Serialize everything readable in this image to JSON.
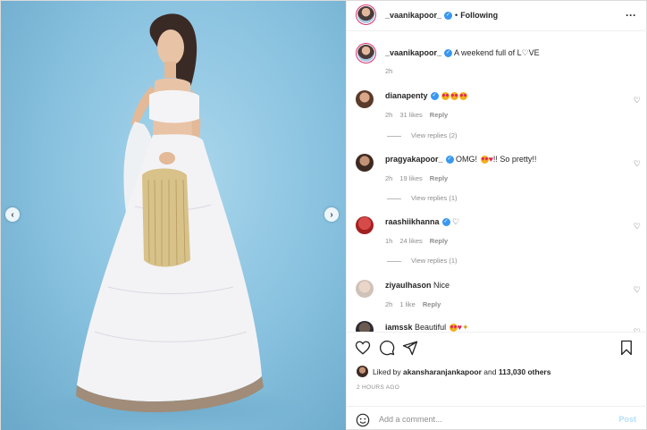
{
  "header": {
    "username": "_vaanikapoor_",
    "separator": "•",
    "follow_status": "Following",
    "more_label": "•••"
  },
  "caption": {
    "username": "_vaanikapoor_",
    "text": "A weekend full of L♡VE",
    "time": "2h"
  },
  "comments": [
    {
      "username": "dianapenty",
      "verified": true,
      "text": "",
      "time": "2h",
      "likes": "31 likes",
      "reply": "Reply",
      "view_replies": "View replies (2)"
    },
    {
      "username": "pragyakapoor_",
      "verified": true,
      "text_before": "OMG!",
      "text_after": "!! So pretty!!",
      "time": "2h",
      "likes": "19 likes",
      "reply": "Reply",
      "view_replies": "View replies (1)"
    },
    {
      "username": "raashiikhanna",
      "verified": true,
      "text": "",
      "time": "1h",
      "likes": "24 likes",
      "reply": "Reply",
      "view_replies": "View replies (1)"
    },
    {
      "username": "ziyaulhason",
      "verified": false,
      "text": "Nice",
      "time": "2h",
      "likes": "1 like",
      "reply": "Reply"
    },
    {
      "username": "iamssk",
      "verified": false,
      "text": "Beautiful",
      "time": "",
      "likes": "",
      "reply": ""
    }
  ],
  "likes": {
    "prefix": "Liked by",
    "user": "akansharanjankapoor",
    "and": "and",
    "count": "113,030 others"
  },
  "timestamp": "2 HOURS AGO",
  "add_comment": {
    "placeholder": "Add a comment...",
    "post_label": "Post"
  },
  "icons": {
    "like": "heart-icon",
    "comment": "comment-icon",
    "share": "share-icon",
    "save": "bookmark-icon",
    "emoji": "smiley-icon"
  },
  "colors": {
    "verified": "#3897f0",
    "post_disabled": "#b2dffc",
    "ring": "#d8326e",
    "photo_bg": "#86c0de"
  }
}
